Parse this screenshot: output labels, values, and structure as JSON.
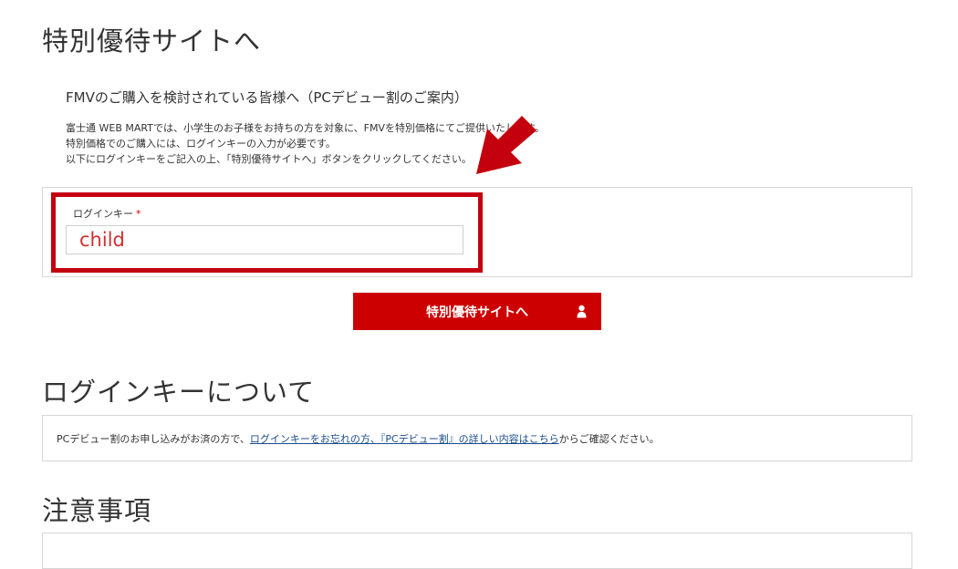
{
  "page": {
    "title": "特別優待サイトへ",
    "lead": "FMVのご購入を検討されている皆様へ（PCデビュー割のご案内）",
    "description": [
      "富士通 WEB MARTでは、小学生のお子様をお持ちの方を対象に、FMVを特別価格にてご提供いたします。",
      "特別価格でのご購入には、ログインキーの入力が必要です。",
      "以下にログインキーをご記入の上、「特別優待サイトへ」ボタンをクリックしてください。"
    ]
  },
  "form": {
    "login_key_label": "ログインキー",
    "required_mark": "*",
    "login_key_value": "child",
    "submit_label": "特別優待サイトへ",
    "submit_icon": "user-icon"
  },
  "about": {
    "heading": "ログインキーについて",
    "text_before": "PCデビュー割のお申し込みがお済の方で、",
    "link_text": "ログインキーをお忘れの方、『PCデビュー割』の詳しい内容はこちら",
    "text_after": "からご確認ください。"
  },
  "notes": {
    "heading": "注意事項"
  },
  "colors": {
    "accent": "#cc0000",
    "highlight": "#c4000e",
    "link": "#1a4c8c",
    "input_text": "#d32f2f"
  },
  "annotation": {
    "arrow_icon": "arrow-icon"
  }
}
